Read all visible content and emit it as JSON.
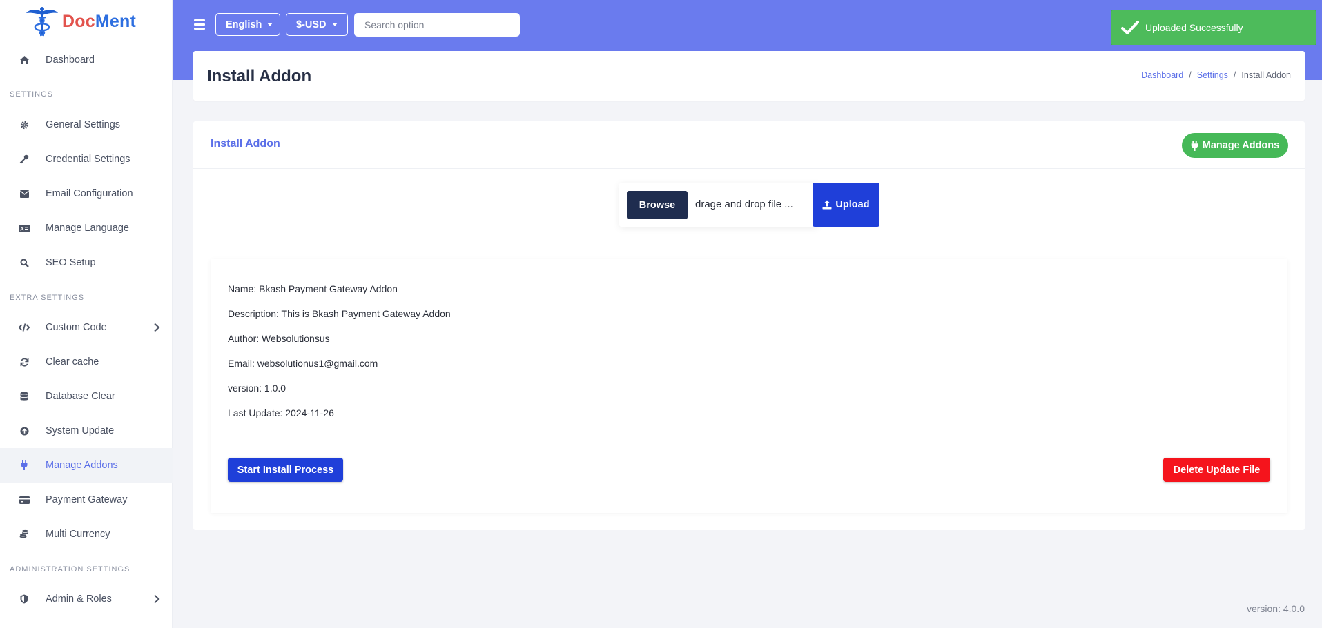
{
  "brand": {
    "name_part1": "Doc",
    "name_part2": "Ment",
    "accent": "#2e6fe0",
    "accent2": "#e2534d"
  },
  "sidebar": {
    "items": [
      {
        "label": "Dashboard",
        "icon": "home-icon"
      },
      {
        "label": "General Settings",
        "icon": "gear-icon"
      },
      {
        "label": "Credential Settings",
        "icon": "key-icon"
      },
      {
        "label": "Email Configuration",
        "icon": "envelope-icon"
      },
      {
        "label": "Manage Language",
        "icon": "language-icon"
      },
      {
        "label": "SEO Setup",
        "icon": "search-icon"
      },
      {
        "label": "Custom Code",
        "icon": "code-icon"
      },
      {
        "label": "Clear cache",
        "icon": "refresh-icon"
      },
      {
        "label": "Database Clear",
        "icon": "database-icon"
      },
      {
        "label": "System Update",
        "icon": "upload-circle-icon"
      },
      {
        "label": "Manage Addons",
        "icon": "plug-icon",
        "active": true
      },
      {
        "label": "Payment Gateway",
        "icon": "credit-card-icon"
      },
      {
        "label": "Multi Currency",
        "icon": "coins-icon"
      },
      {
        "label": "Admin & Roles",
        "icon": "shield-icon"
      }
    ],
    "sections": {
      "settings": "SETTINGS",
      "extra": "EXTRA SETTINGS",
      "admin": "ADMINISTRATION SETTINGS"
    }
  },
  "topbar": {
    "language": "English",
    "currency": "$-USD",
    "search_placeholder": "Search option",
    "color": "#6a7bee"
  },
  "toast": {
    "message": "Uploaded Successfully",
    "color": "#4dbb5b"
  },
  "page": {
    "title": "Install Addon",
    "breadcrumb": [
      "Dashboard",
      "Settings",
      "Install Addon"
    ]
  },
  "card": {
    "title": "Install Addon",
    "manage_button": "Manage Addons",
    "browse_button": "Browse",
    "file_text": "drage and drop file ...",
    "upload_button": "Upload"
  },
  "addon": {
    "name": "Name: Bkash Payment Gateway Addon",
    "description": "Description: This is Bkash Payment Gateway Addon",
    "author": "Author: Websolutionsus",
    "email": "Email: websolutionus1@gmail.com",
    "version": "version: 1.0.0",
    "last_update": "Last Update: 2024-11-26",
    "install_button": "Start Install Process",
    "delete_button": "Delete Update File"
  },
  "footer": {
    "version": "version: 4.0.0"
  }
}
